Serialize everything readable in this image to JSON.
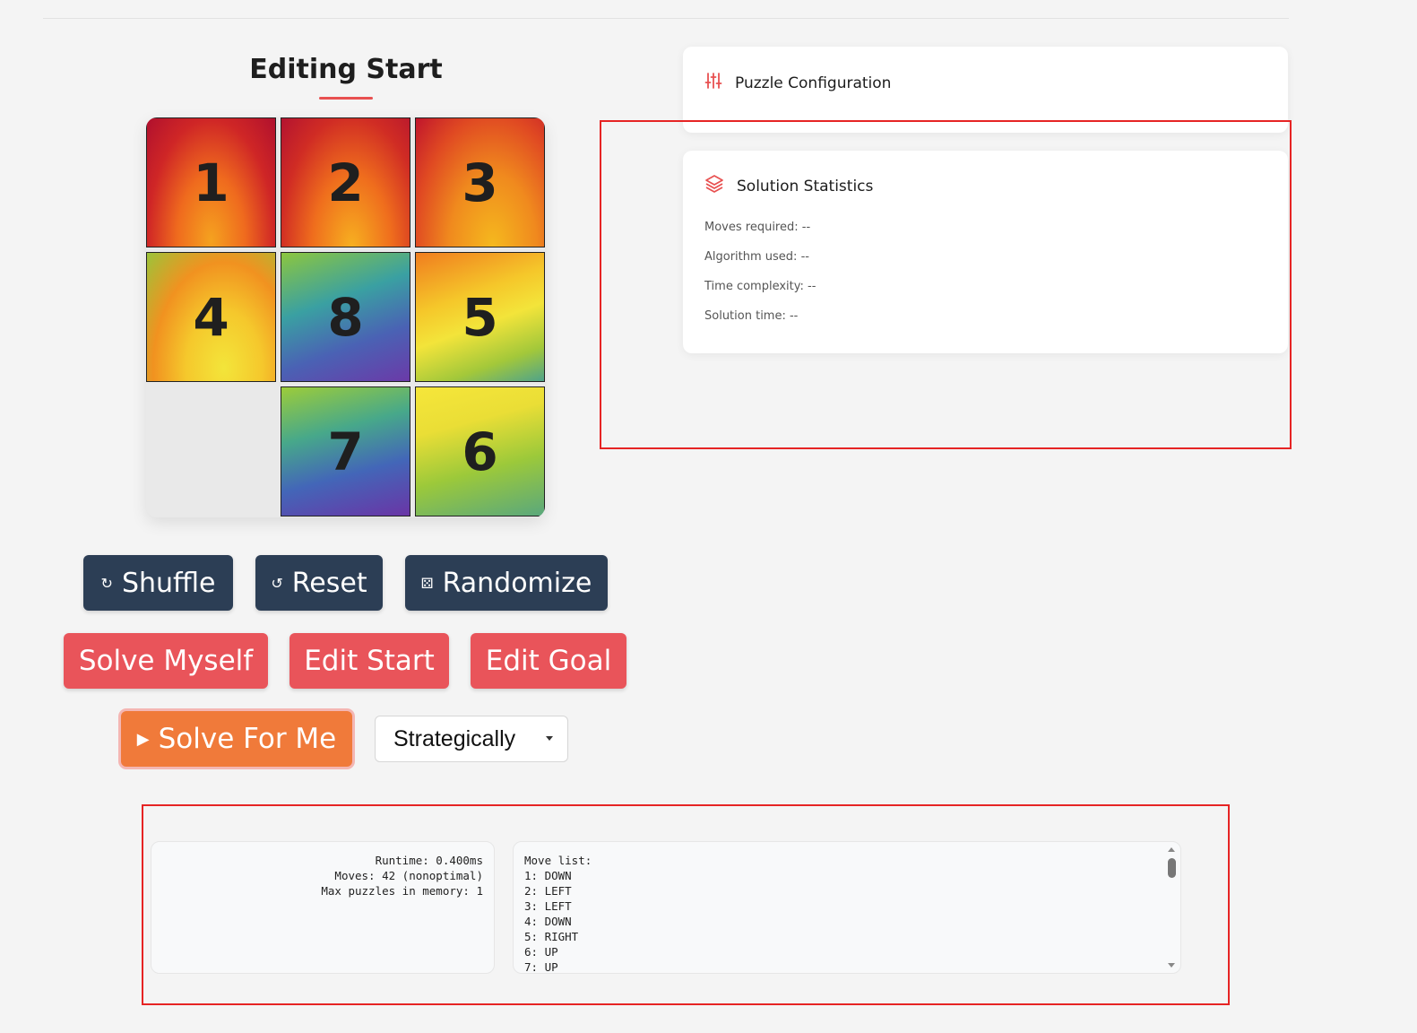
{
  "editor": {
    "title": "Editing Start"
  },
  "board": {
    "tiles": [
      "1",
      "2",
      "3",
      "4",
      "8",
      "5",
      "",
      "7",
      "6"
    ]
  },
  "controls": {
    "shuffle": {
      "icon": "↻",
      "label": "Shuffle"
    },
    "reset": {
      "icon": "↺",
      "label": "Reset"
    },
    "randomize": {
      "icon": "⚄",
      "label": "Randomize"
    },
    "solve_myself": "Solve Myself",
    "edit_start": "Edit Start",
    "edit_goal": "Edit Goal",
    "solve_for_me": {
      "icon": "▶",
      "label": "Solve For Me"
    },
    "strategy_select": {
      "value": "Strategically"
    }
  },
  "config_card": {
    "title": "Puzzle Configuration",
    "icon": "sliders-icon"
  },
  "stats_card": {
    "title": "Solution Statistics",
    "icon": "layers-icon",
    "moves_required": "Moves required: --",
    "algorithm_used": "Algorithm used: --",
    "time_complexity": "Time complexity: --",
    "solution_time": "Solution time: --"
  },
  "output": {
    "runtime": "Runtime: 0.400ms",
    "moves": "Moves: 42 (nonoptimal)",
    "max_puzzles": "Max puzzles in memory: 1",
    "move_list_header": "Move list:",
    "move_list": [
      "1: DOWN",
      "2: LEFT",
      "3: LEFT",
      "4: DOWN",
      "5: RIGHT",
      "6: UP",
      "7: UP"
    ]
  },
  "colors": {
    "accent_red": "#e9545a",
    "dark_button": "#2c3e55",
    "solve_orange": "#f07a3a",
    "highlight_box": "#e62424"
  }
}
